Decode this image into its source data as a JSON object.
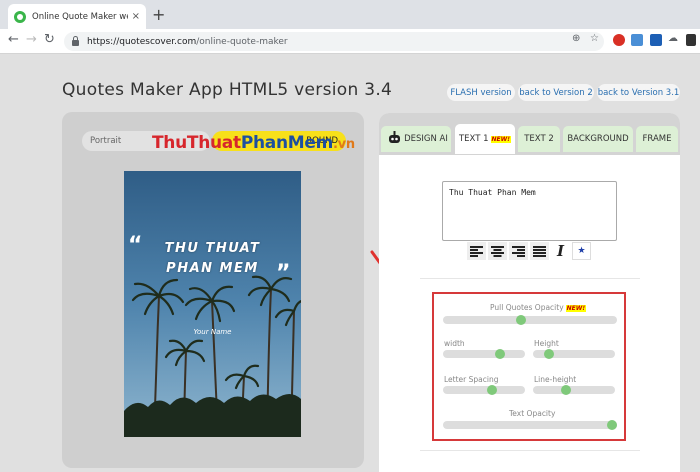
{
  "browser": {
    "tab_title": "Online Quote Maker web applica",
    "tab_close": "×",
    "new_tab": "+",
    "url_host": "https://quotescover.com",
    "url_path": "/online-quote-maker",
    "back": "←",
    "forward": "→",
    "reload": "↻"
  },
  "page": {
    "title": "Quotes Maker App HTML5 version 3.4",
    "versions": [
      "FLASH version",
      "back to Version 2",
      "back to Version 3.1"
    ]
  },
  "editor": {
    "layout_option": "Portrait",
    "yellow_pill_text": "ROUND",
    "watermark": {
      "part1": "Thu",
      "part2": "Thuat",
      "part3": "Phan",
      "part4": "Mem",
      "part5": ".vn"
    },
    "quote_open": "“",
    "quote_close": "”",
    "quote_line1": "THU THUAT",
    "quote_line2": "PHAN MEM",
    "author": "Your Name"
  },
  "panel": {
    "tabs": [
      "DESIGN AI",
      "TEXT 1",
      "TEXT 2",
      "BACKGROUND",
      "FRAME"
    ],
    "new_badge": "NEW!",
    "text_value": "Thu Thuat Phan Mem",
    "italic_glyph": "I",
    "star_glyph": "★",
    "sliders": {
      "pull_quotes_opacity": {
        "label": "Pull Quotes Opacity",
        "value": 0.45
      },
      "width": {
        "label": "width",
        "value": 0.7
      },
      "height": {
        "label": "Height",
        "value": 0.2
      },
      "letter_spacing": {
        "label": "Letter Spacing",
        "value": 0.6
      },
      "line_height": {
        "label": "Line-height",
        "value": 0.4
      },
      "text_opacity": {
        "label": "Text Opacity",
        "value": 1.0
      }
    }
  },
  "colors": {
    "accent_green": "#7fc97a",
    "highlight_red": "#d6393a",
    "link_blue": "#2a6fb0",
    "pill_yellow": "#f7e01a"
  }
}
